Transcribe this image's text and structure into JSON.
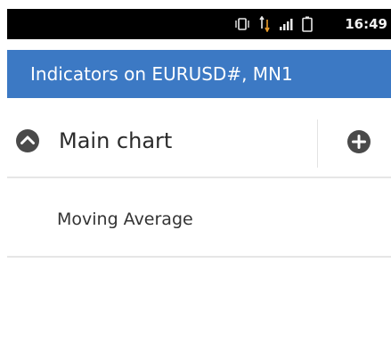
{
  "status_bar": {
    "time": "16:49",
    "icons": [
      "vibrate-icon",
      "data-transfer-icon",
      "signal-icon",
      "battery-icon"
    ]
  },
  "action_bar": {
    "title": "Indicators on EURUSD#, MN1",
    "color": "#3c79c4"
  },
  "section": {
    "title": "Main chart",
    "collapse_icon": "chevron-up-circle-icon",
    "add_icon": "plus-circle-icon"
  },
  "indicators": [
    {
      "label": "Moving Average"
    }
  ]
}
